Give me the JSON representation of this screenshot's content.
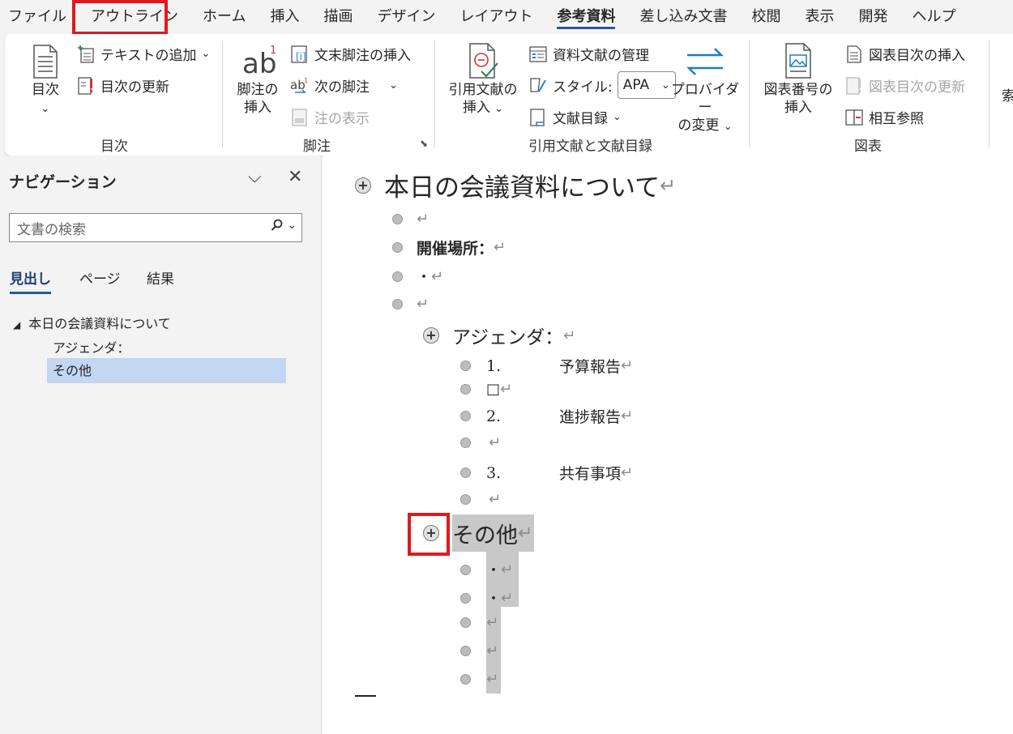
{
  "window": {
    "tabs": [
      "ファイル",
      "アウトライン",
      "ホーム",
      "挿入",
      "描画",
      "デザイン",
      "レイアウト",
      "参考資料",
      "差し込み文書",
      "校閲",
      "表示",
      "開発",
      "ヘルプ"
    ],
    "active_tab": "参考資料"
  },
  "ribbon": {
    "toc": {
      "group_label": "目次",
      "toc_button": "目次",
      "add_text": "テキストの追加",
      "update_toc": "目次の更新"
    },
    "footnotes": {
      "group_label": "脚注",
      "insert_footnote_line1": "脚注の",
      "insert_footnote_line2": "挿入",
      "insert_endnote": "文末脚注の挿入",
      "next_footnote": "次の脚注",
      "show_notes": "注の表示"
    },
    "citations": {
      "group_label": "引用文献と文献目録",
      "insert_citation_line1": "引用文献の",
      "insert_citation_line2": "挿入",
      "manage_sources": "資料文献の管理",
      "style_label": "スタイル:",
      "style_value": "APA",
      "bibliography": "文献目録",
      "provider_line1": "プロバイダー",
      "provider_line2": "の変更"
    },
    "captions": {
      "group_label": "図表",
      "insert_caption_line1": "図表番号の",
      "insert_caption_line2": "挿入",
      "insert_table_of_figures": "図表目次の挿入",
      "update_table": "図表目次の更新",
      "cross_reference": "相互参照"
    },
    "cut_off_label": "索"
  },
  "navigation": {
    "title": "ナビゲーション",
    "search_placeholder": "文書の検索",
    "tabs": [
      "見出し",
      "ページ",
      "結果"
    ],
    "headings": [
      {
        "text": "本日の会議資料について",
        "level": 1
      },
      {
        "text": "アジェンダ：",
        "level": 2
      },
      {
        "text": "その他",
        "level": 2,
        "selected": true
      }
    ]
  },
  "document": {
    "title": "本日の会議資料について",
    "venue_label": "開催場所：",
    "dot": "・",
    "agenda_heading": "アジェンダ：",
    "agenda_items": [
      {
        "num": "1.",
        "text": "予算報告"
      },
      {
        "num": "2.",
        "text": "進捗報告"
      },
      {
        "num": "3.",
        "text": "共有事項"
      }
    ],
    "box_char": "□",
    "other_heading": "その他",
    "pilcrow": "↵"
  }
}
